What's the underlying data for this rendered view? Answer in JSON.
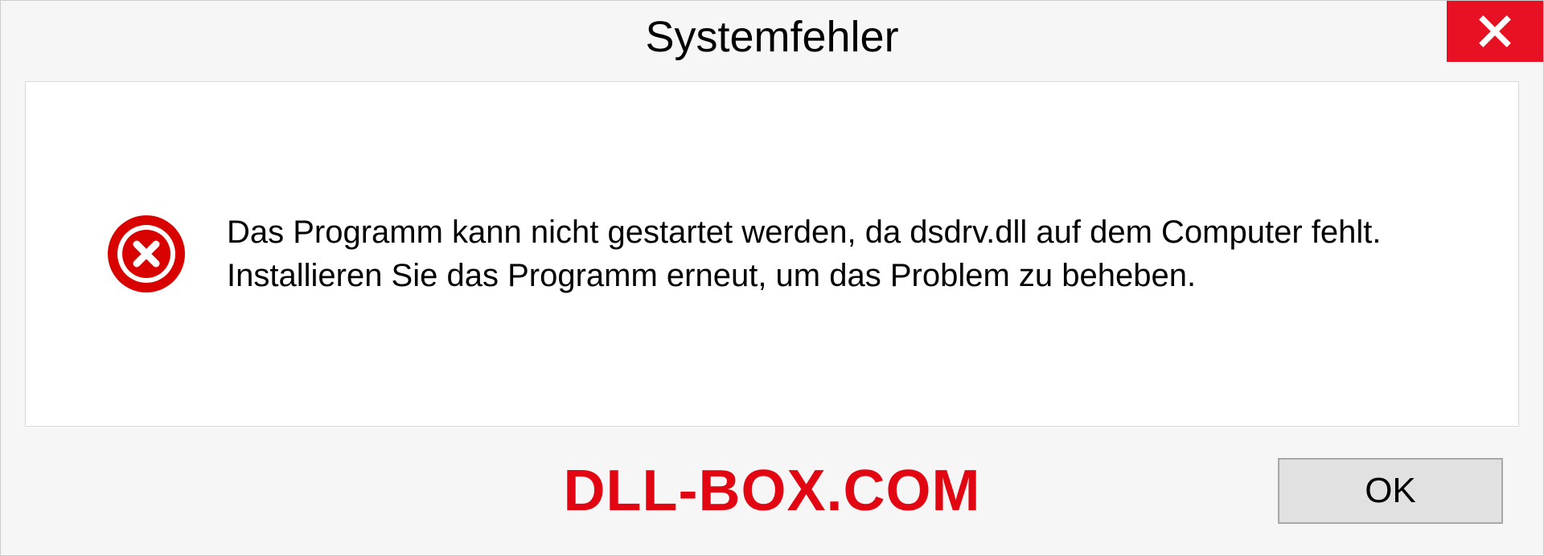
{
  "dialog": {
    "title": "Systemfehler",
    "message": "Das Programm kann nicht gestartet werden, da dsdrv.dll auf dem Computer fehlt. Installieren Sie das Programm erneut, um das Problem zu beheben.",
    "ok_label": "OK"
  },
  "watermark": "DLL-BOX.COM",
  "colors": {
    "close_red": "#e81123",
    "error_red": "#d90000",
    "watermark_red": "#e20613"
  }
}
